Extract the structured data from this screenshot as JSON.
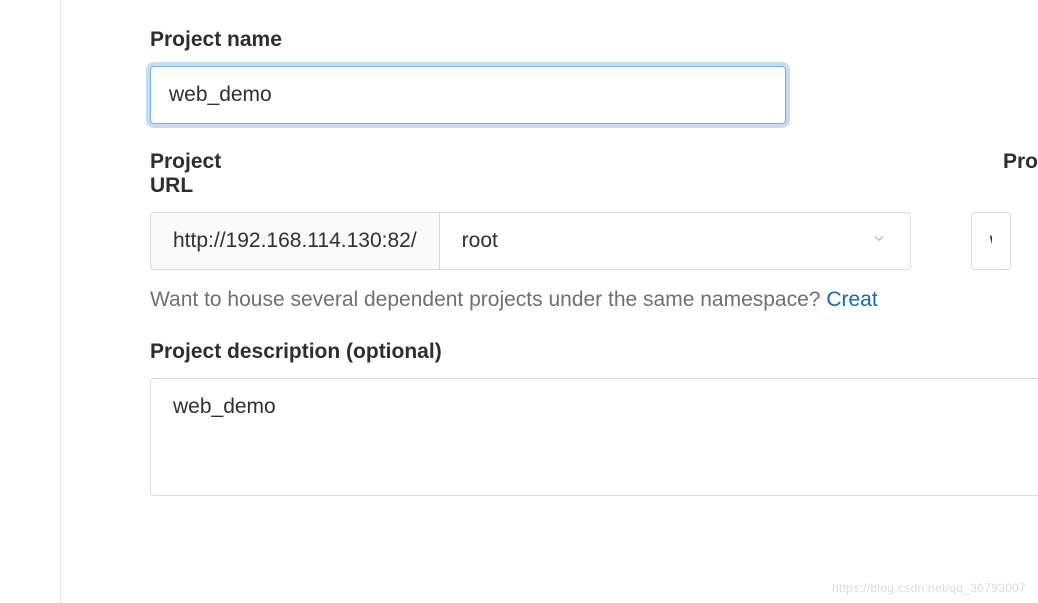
{
  "project_name": {
    "label": "Project name",
    "value": "web_demo"
  },
  "project_url": {
    "label": "Project URL",
    "base_url": "http://192.168.114.130:82/",
    "namespace": "root"
  },
  "project_slug": {
    "label": "Pro",
    "value": "w"
  },
  "namespace_hint": {
    "text": "Want to house several dependent projects under the same namespace? ",
    "link_text": "Creat"
  },
  "project_description": {
    "label": "Project description (optional)",
    "value": "web_demo"
  },
  "watermark": "https://blog.csdn.net/qq_36793007"
}
